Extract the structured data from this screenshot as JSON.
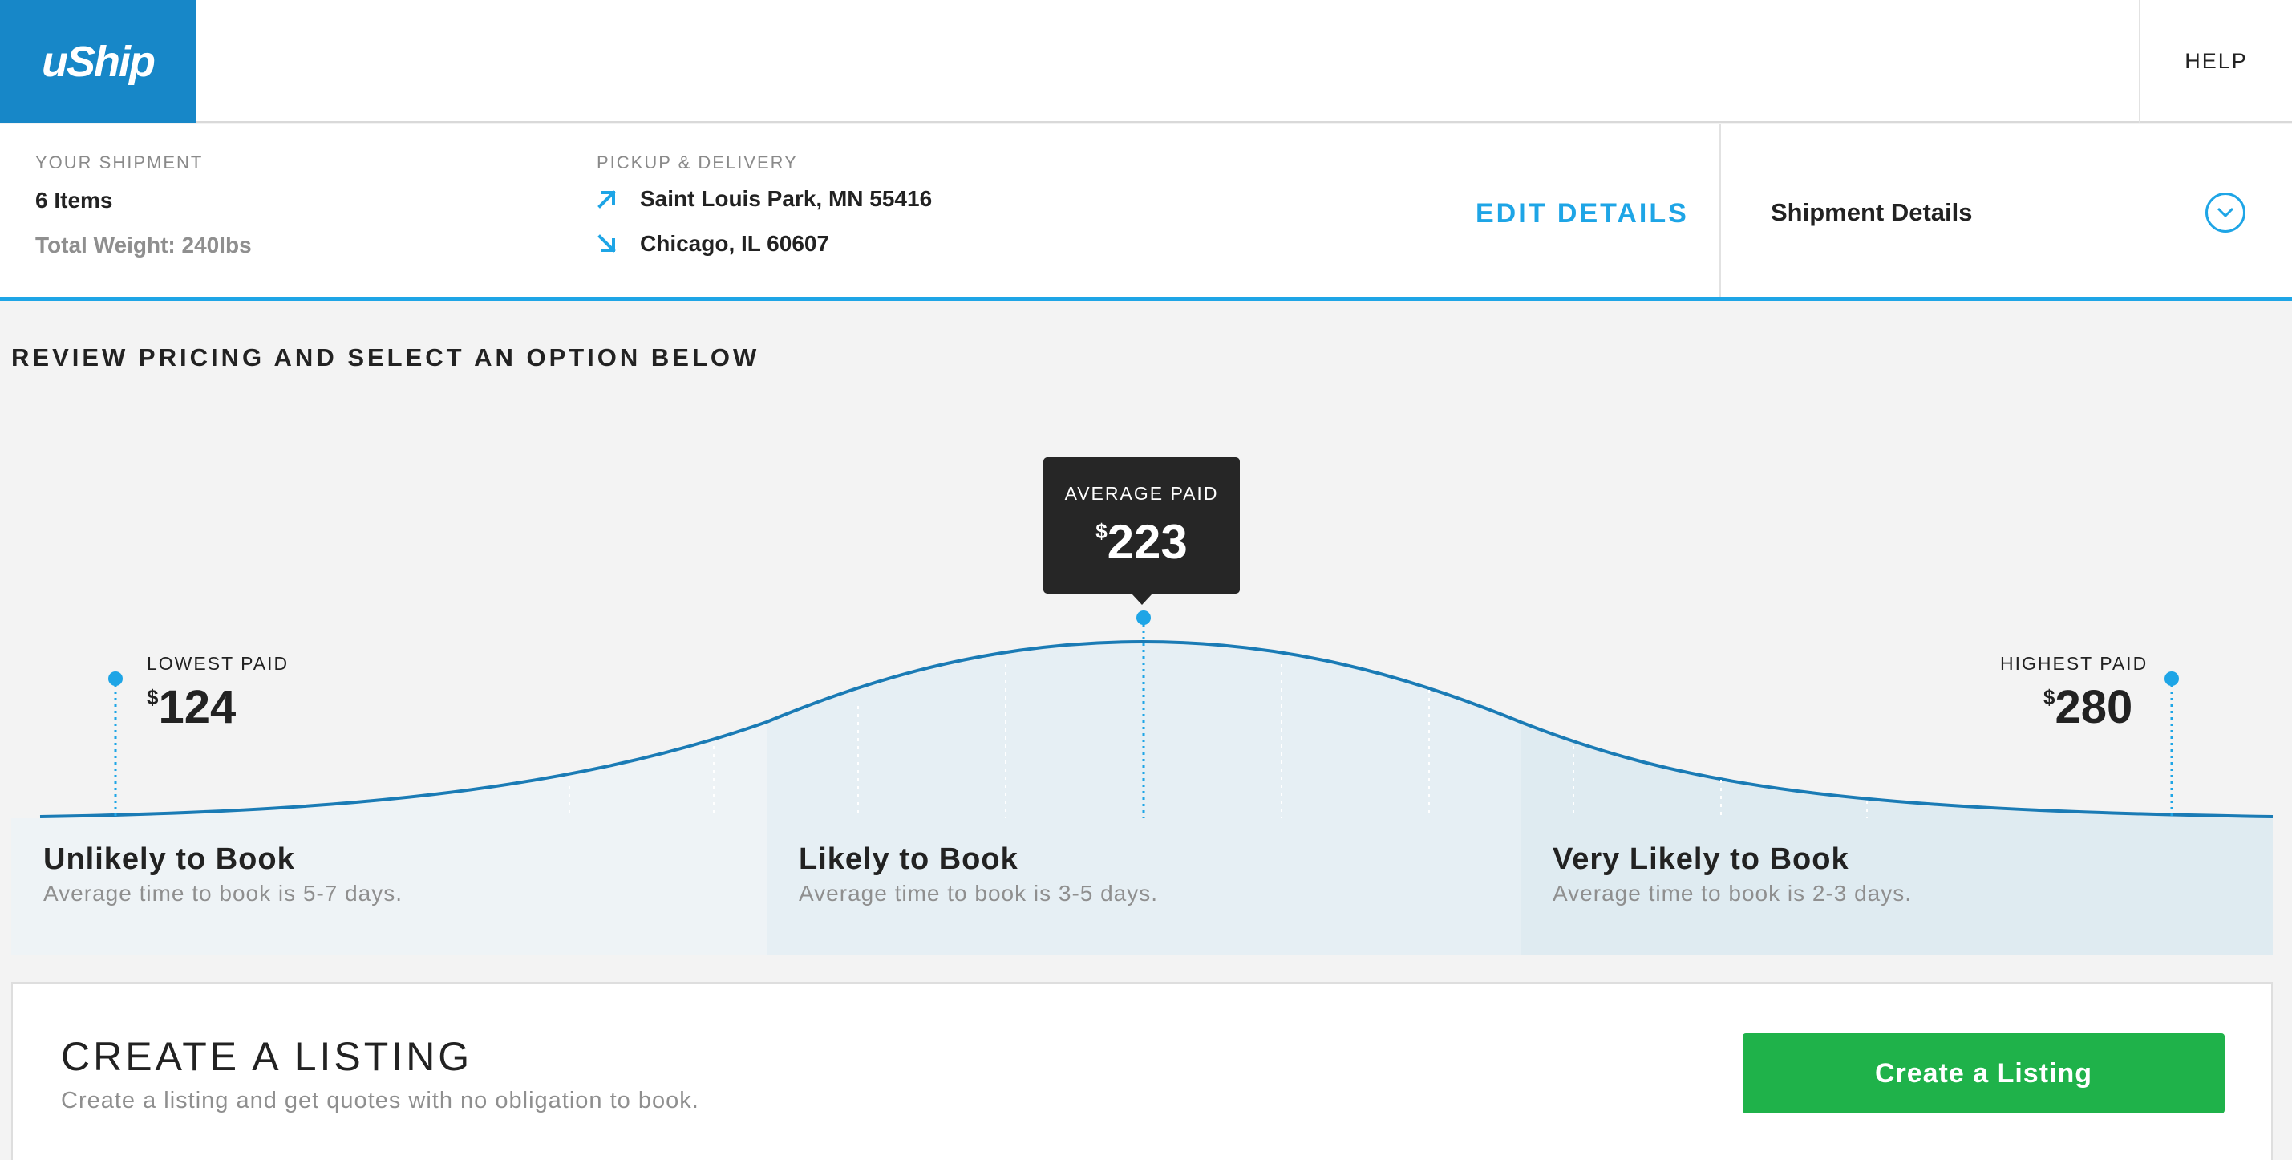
{
  "header": {
    "logo_text": "uShip",
    "help_label": "HELP",
    "brand_color": "#1787c8"
  },
  "shipment": {
    "your_shipment_label": "YOUR SHIPMENT",
    "items": "6 Items",
    "weight": "Total Weight: 240lbs",
    "pickup_delivery_label": "PICKUP & DELIVERY",
    "pickup": "Saint Louis Park, MN 55416",
    "delivery": "Chicago, IL 60607",
    "edit_label": "EDIT DETAILS",
    "details_label": "Shipment Details"
  },
  "review_heading": "REVIEW PRICING AND SELECT AN OPTION BELOW",
  "pricing": {
    "lowest_label": "LOWEST PAID",
    "lowest_value": "124",
    "average_label": "AVERAGE PAID",
    "average_value": "223",
    "highest_label": "HIGHEST PAID",
    "highest_value": "280",
    "currency": "$"
  },
  "zones": [
    {
      "title": "Unlikely to Book",
      "subtitle": "Average time to book is 5-7 days."
    },
    {
      "title": "Likely to Book",
      "subtitle": "Average time to book is 3-5 days."
    },
    {
      "title": "Very Likely to Book",
      "subtitle": "Average time to book is 2-3 days."
    }
  ],
  "listing": {
    "heading": "CREATE A LISTING",
    "subtext": "Create a listing and get quotes with no obligation to book.",
    "button_label": "Create a Listing",
    "button_color": "#1fb24a"
  },
  "colors": {
    "accent": "#1ea5e6",
    "curve": "#1a7bb5",
    "zone1": "#eef3f6",
    "zone2": "#e6eff4",
    "zone3": "#dfebf1"
  }
}
